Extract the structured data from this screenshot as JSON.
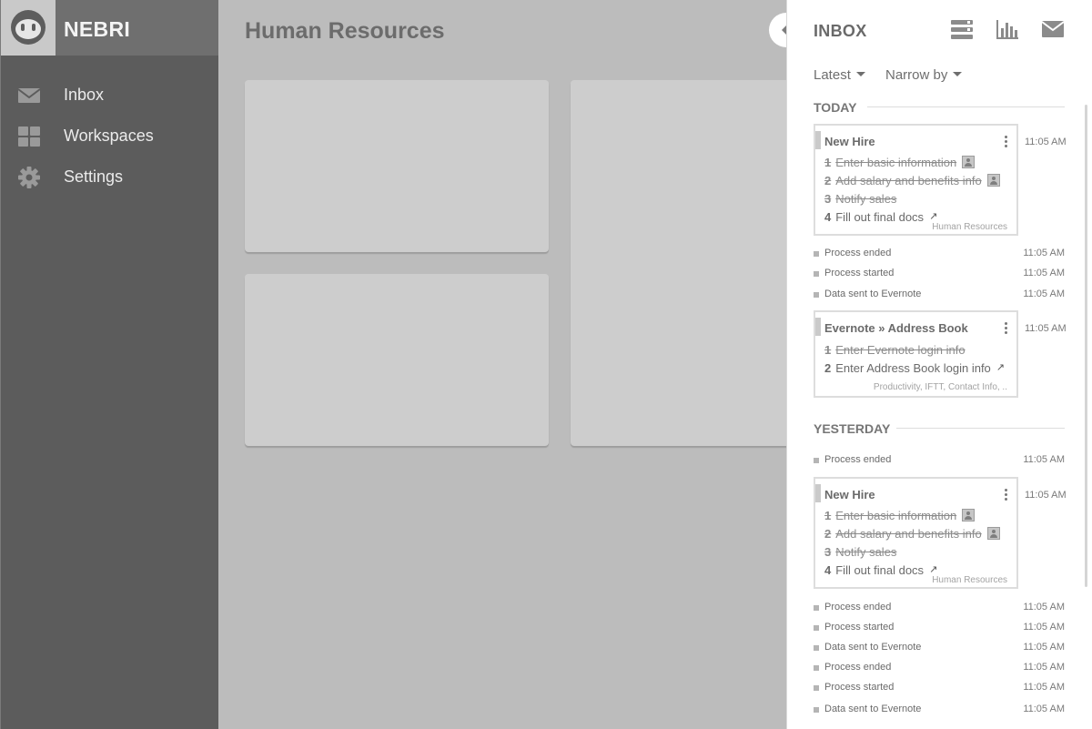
{
  "brand": {
    "name": "NEBRI"
  },
  "nav": [
    {
      "label": "Inbox",
      "icon": "envelope-icon"
    },
    {
      "label": "Workspaces",
      "icon": "grid-icon"
    },
    {
      "label": "Settings",
      "icon": "gear-icon"
    }
  ],
  "main": {
    "title": "Human Resources"
  },
  "inbox": {
    "title": "INBOX",
    "header_icons": [
      "list-view-icon",
      "bar-chart-icon",
      "envelope-icon"
    ],
    "filters": {
      "sort": "Latest",
      "narrow": "Narrow by"
    },
    "sections": [
      {
        "label": "TODAY",
        "items": [
          {
            "kind": "card",
            "title": "New Hire",
            "time": "11:05 AM",
            "steps": [
              {
                "num": "1",
                "text": "Enter basic information",
                "done": true,
                "avatar": true
              },
              {
                "num": "2",
                "text": "Add salary and benefits info",
                "done": true,
                "avatar": true
              },
              {
                "num": "3",
                "text": "Notify sales",
                "done": true
              },
              {
                "num": "4",
                "text": "Fill out final docs",
                "done": false,
                "link": true
              }
            ],
            "tag": "Human Resources"
          },
          {
            "kind": "event",
            "label": "Process ended",
            "time": "11:05 AM"
          },
          {
            "kind": "event",
            "label": "Process started",
            "time": "11:05 AM"
          },
          {
            "kind": "event",
            "label": "Data sent to Evernote",
            "time": "11:05 AM"
          },
          {
            "kind": "card",
            "title": "Evernote » Address Book",
            "time": "11:05 AM",
            "steps": [
              {
                "num": "1",
                "text": "Enter Evernote login info",
                "done": true
              },
              {
                "num": "2",
                "text": "Enter Address Book login info",
                "done": false,
                "link": true
              }
            ],
            "tag": "Productivity, IFTT, Contact Info, .."
          }
        ]
      },
      {
        "label": "YESTERDAY",
        "items": [
          {
            "kind": "event",
            "label": "Process ended",
            "time": "11:05 AM"
          },
          {
            "kind": "card",
            "title": "New Hire",
            "time": "11:05 AM",
            "steps": [
              {
                "num": "1",
                "text": "Enter basic information",
                "done": true,
                "avatar": true
              },
              {
                "num": "2",
                "text": "Add salary and benefits info",
                "done": true,
                "avatar": true
              },
              {
                "num": "3",
                "text": "Notify sales",
                "done": true
              },
              {
                "num": "4",
                "text": "Fill out final docs",
                "done": false,
                "link": true
              }
            ],
            "tag": "Human Resources"
          },
          {
            "kind": "event",
            "label": "Process ended",
            "time": "11:05 AM"
          },
          {
            "kind": "event",
            "label": "Process started",
            "time": "11:05 AM"
          },
          {
            "kind": "event",
            "label": "Data sent to Evernote",
            "time": "11:05 AM"
          },
          {
            "kind": "event",
            "label": "Process ended",
            "time": "11:05 AM"
          },
          {
            "kind": "event",
            "label": "Process started",
            "time": "11:05 AM"
          },
          {
            "kind": "event",
            "label": "Data sent to Evernote",
            "time": "11:05 AM"
          }
        ]
      }
    ]
  },
  "colors": {
    "sidebar": "#5c5c5c",
    "brand_bar": "#6f6f6f",
    "main_bg": "#bcbcbc",
    "card": "#cdcdcd",
    "panel": "#ffffff"
  }
}
